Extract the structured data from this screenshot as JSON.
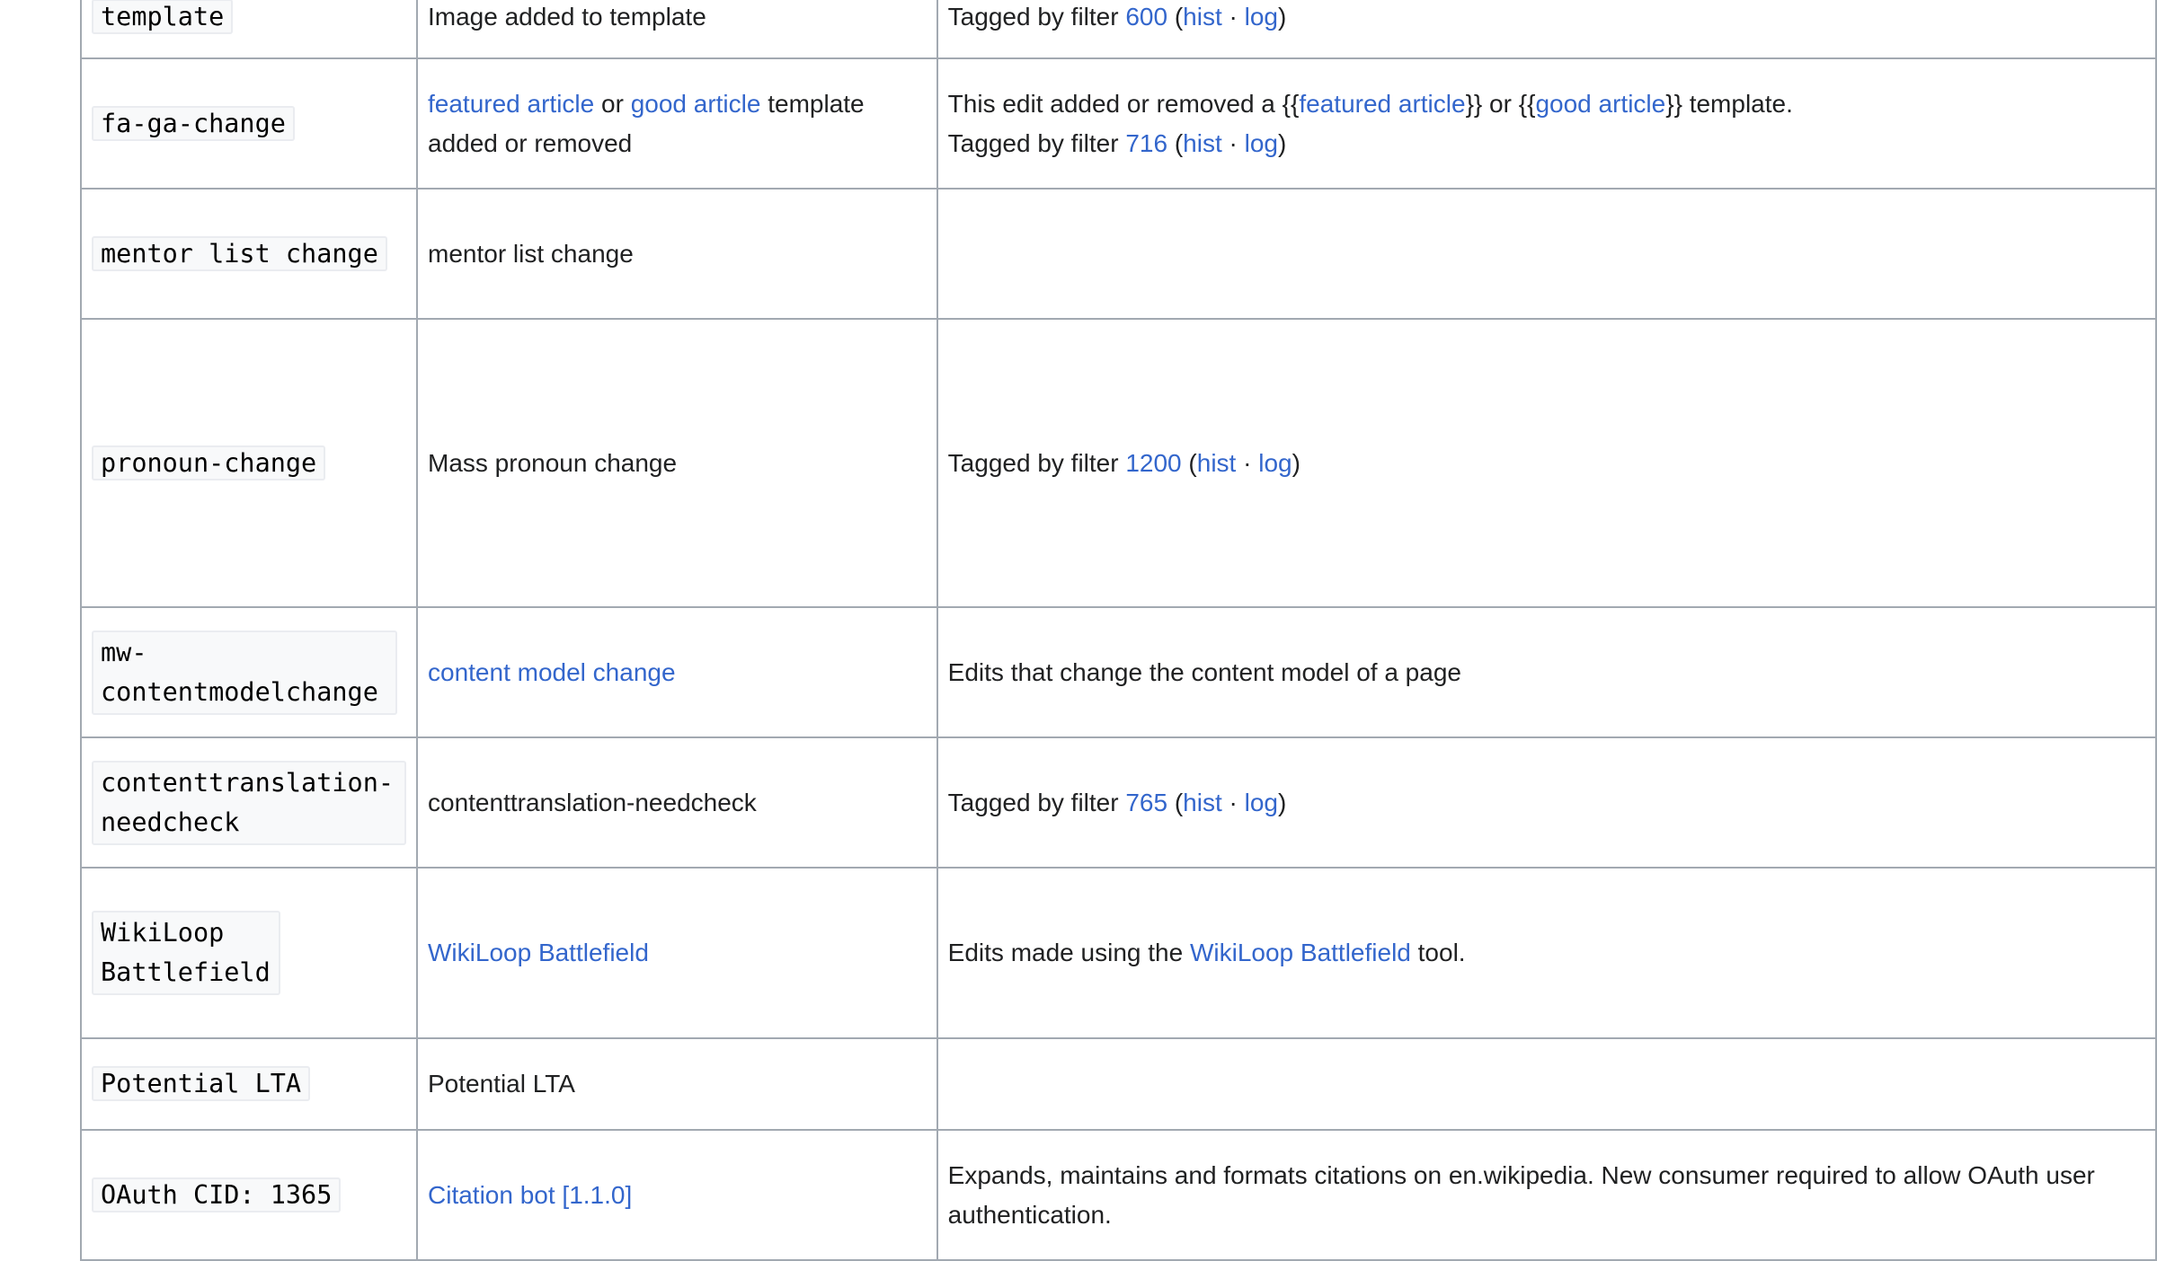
{
  "rows": [
    {
      "tag": "template",
      "display": [
        {
          "t": "Image added to template"
        }
      ],
      "description": [
        {
          "t": "Tagged by filter "
        },
        {
          "a": "600"
        },
        {
          "t": " ("
        },
        {
          "a": "hist"
        },
        {
          "t": " · "
        },
        {
          "a": "log"
        },
        {
          "t": ")"
        }
      ]
    },
    {
      "tag": "fa-ga-change",
      "display": [
        {
          "a": "featured article"
        },
        {
          "t": " or "
        },
        {
          "a": "good article"
        },
        {
          "t": " template added or removed"
        }
      ],
      "description": [
        {
          "t": "This edit added or removed a {{"
        },
        {
          "a": "featured article"
        },
        {
          "t": "}} or {{"
        },
        {
          "a": "good article"
        },
        {
          "t": "}} template."
        },
        {
          "br": true
        },
        {
          "t": "Tagged by filter "
        },
        {
          "a": "716"
        },
        {
          "t": " ("
        },
        {
          "a": "hist"
        },
        {
          "t": " · "
        },
        {
          "a": "log"
        },
        {
          "t": ")"
        }
      ]
    },
    {
      "tag": "mentor list change",
      "display": [
        {
          "t": "mentor list change"
        }
      ],
      "description": []
    },
    {
      "tag": "pronoun-change",
      "display": [
        {
          "t": "Mass pronoun change"
        }
      ],
      "description": [
        {
          "t": "Tagged by filter "
        },
        {
          "a": "1200"
        },
        {
          "t": " ("
        },
        {
          "a": "hist"
        },
        {
          "t": " · "
        },
        {
          "a": "log"
        },
        {
          "t": ")"
        }
      ]
    },
    {
      "tag": "mw-contentmodelchange",
      "display": [
        {
          "a": "content model change"
        }
      ],
      "description": [
        {
          "t": "Edits that change the content model of a page"
        }
      ]
    },
    {
      "tag": "contenttranslation-needcheck",
      "display": [
        {
          "t": "contenttranslation-needcheck"
        }
      ],
      "description": [
        {
          "t": "Tagged by filter "
        },
        {
          "a": "765"
        },
        {
          "t": " ("
        },
        {
          "a": "hist"
        },
        {
          "t": " · "
        },
        {
          "a": "log"
        },
        {
          "t": ")"
        }
      ]
    },
    {
      "tag": "WikiLoop Battlefield",
      "display": [
        {
          "a": "WikiLoop Battlefield"
        }
      ],
      "description": [
        {
          "t": "Edits made using the "
        },
        {
          "a": "WikiLoop Battlefield"
        },
        {
          "t": " tool."
        }
      ]
    },
    {
      "tag": "Potential LTA",
      "display": [
        {
          "t": "Potential LTA"
        }
      ],
      "description": []
    },
    {
      "tag": "OAuth CID: 1365",
      "display": [
        {
          "a": "Citation bot [1.1.0]"
        }
      ],
      "description": [
        {
          "t": "Expands, maintains and formats citations on en.wikipedia. New consumer required to allow OAuth user authentication."
        }
      ]
    }
  ]
}
